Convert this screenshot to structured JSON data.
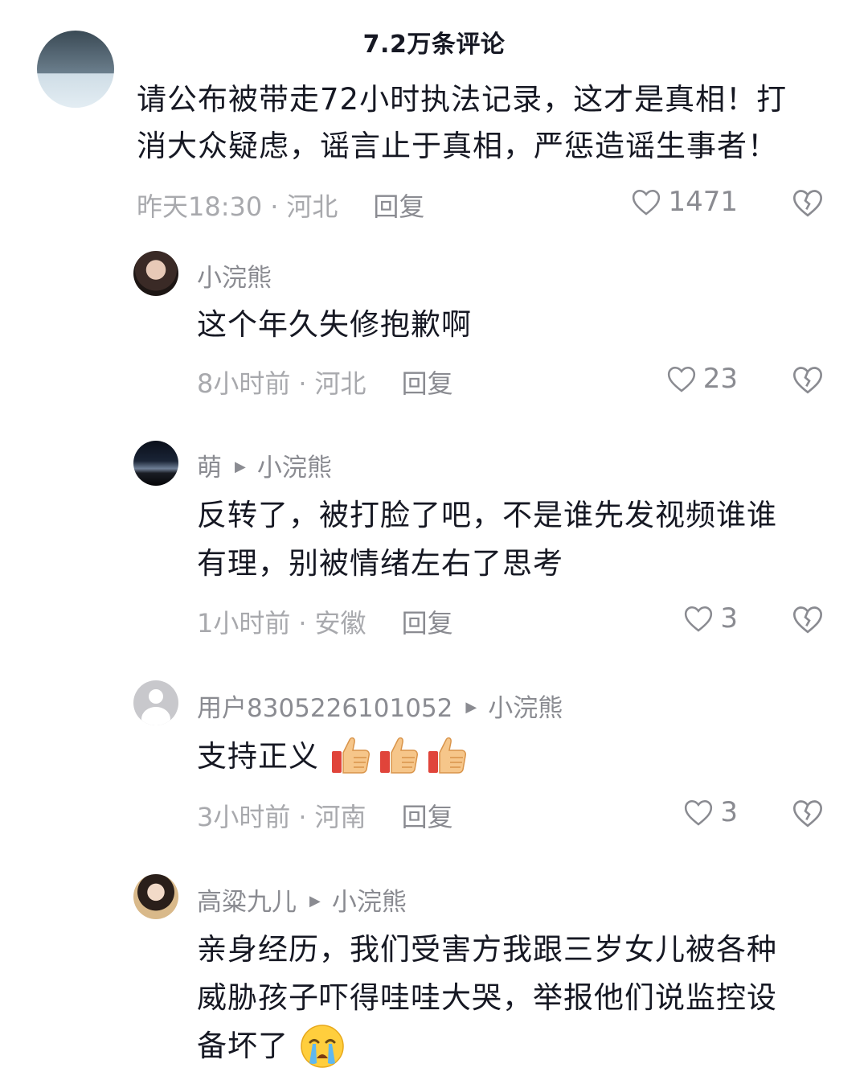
{
  "header": {
    "title": "7.2万条评论"
  },
  "comments": [
    {
      "line1": "请公布被带走72小时执法记录，这才是真相！打",
      "line2": "消大众疑虑，谣言止于真相，严惩造谣生事者！",
      "time": "昨天18:30",
      "location": "河北",
      "reply": "回复",
      "likes": "1471"
    }
  ],
  "replies": [
    {
      "user": "小浣熊",
      "text": "这个年久失修抱歉啊",
      "time": "8小时前",
      "location": "河北",
      "reply": "回复",
      "likes": "23"
    },
    {
      "user": "萌",
      "reply_to": "小浣熊",
      "line1": "反转了，被打脸了吧，不是谁先发视频谁谁",
      "line2": "有理，别被情绪左右了思考",
      "time": "1小时前",
      "location": "安徽",
      "reply": "回复",
      "likes": "3"
    },
    {
      "user": "用户8305226101052",
      "reply_to": "小浣熊",
      "text": "支持正义",
      "emojis": [
        "thumbs-up",
        "thumbs-up",
        "thumbs-up"
      ],
      "time": "3小时前",
      "location": "河南",
      "reply": "回复",
      "likes": "3"
    },
    {
      "user": "高粱九儿",
      "reply_to": "小浣熊",
      "line1": "亲身经历，我们受害方我跟三岁女儿被各种",
      "line2": "威胁孩子吓得哇哇大哭，举报他们说监控设",
      "line3": "备坏了",
      "emoji": "crying-face"
    }
  ],
  "separator": "·",
  "colors": {
    "text": "#161823",
    "secondary": "#8a8b91",
    "tertiary": "#a8a9ad"
  }
}
